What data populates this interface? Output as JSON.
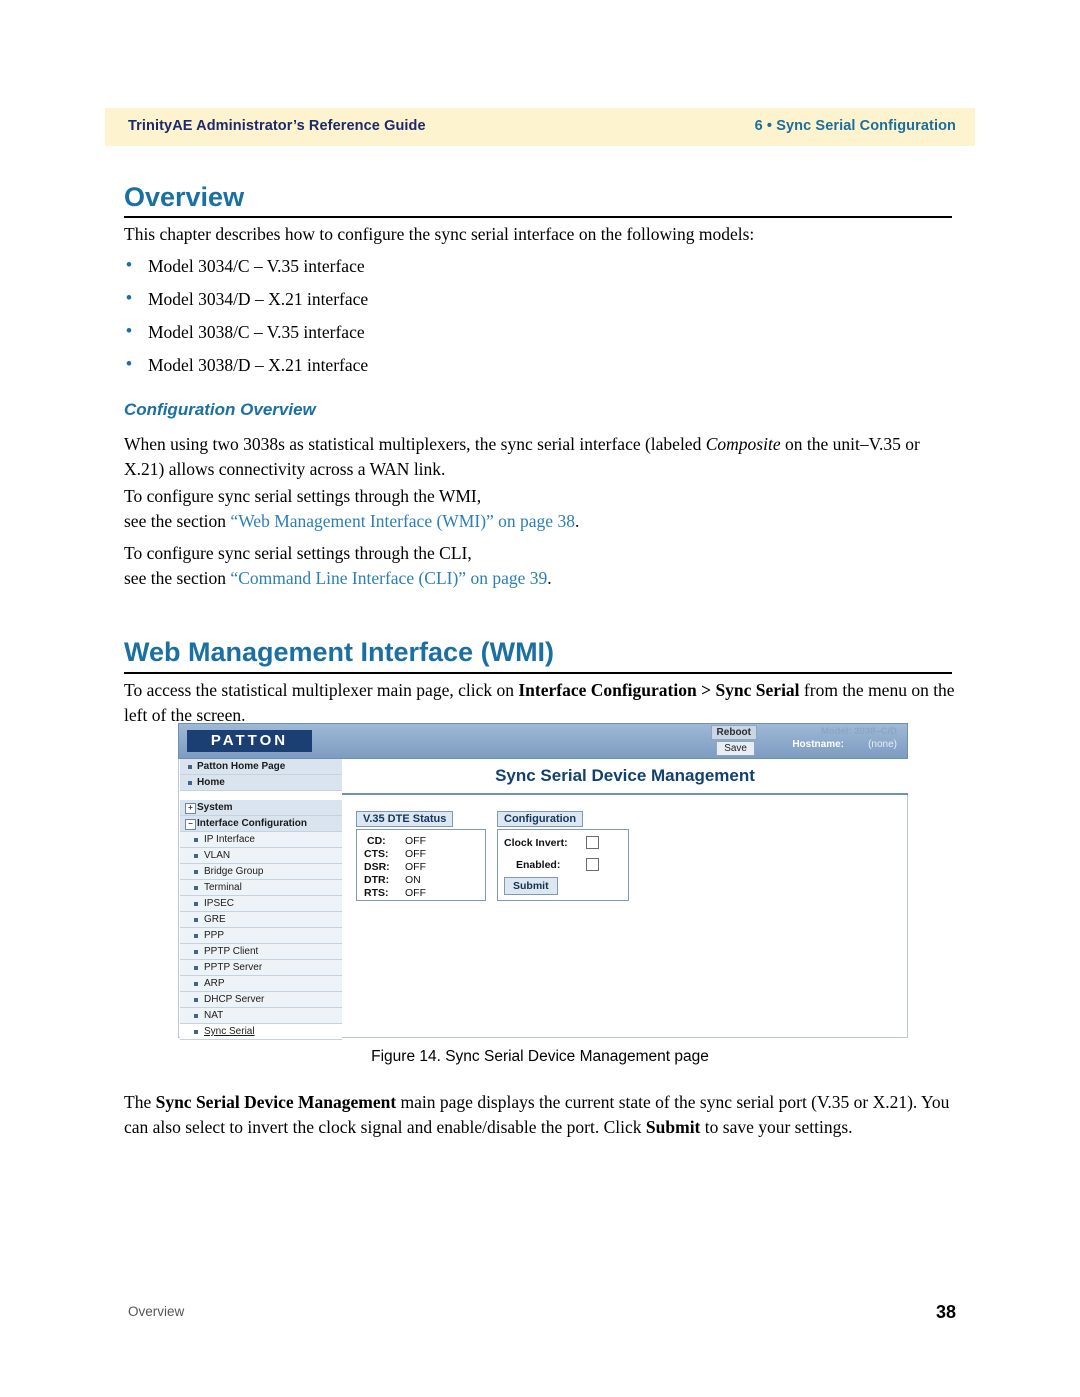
{
  "header": {
    "left": "TrinityAE Administrator’s Reference Guide",
    "right": "6 • Sync Serial Configuration"
  },
  "overview": {
    "heading": "Overview",
    "intro": "This chapter describes how to configure the sync serial interface on the following models:",
    "models": [
      "Model 3034/C – V.35 interface",
      "Model 3034/D – X.21 interface",
      "Model 3038/C – V.35 interface",
      "Model 3038/D – X.21 interface"
    ],
    "config_heading": "Configuration Overview",
    "para1_a": "When using two 3038s as statistical multiplexers, the sync serial interface (labeled ",
    "para1_italic": "Composite",
    "para1_b": " on the unit–V.35 or X.21) allows connectivity across a WAN link.",
    "para2": "To configure sync serial settings through the WMI,",
    "para3_a": "see the section ",
    "para3_link": "“Web Management Interface (WMI)” on page 38",
    "para3_b": ".",
    "para4": "To configure sync serial settings through the CLI,",
    "para5_a": "see the section ",
    "para5_link": "“Command Line Interface (CLI)” on page 39",
    "para5_b": "."
  },
  "wmi_section": {
    "heading": "Web Management Interface (WMI)",
    "para_a": "To access the statistical multiplexer main page, click on ",
    "para_bold": "Interface Configuration > Sync Serial",
    "para_b": " from the menu on the left of the screen.",
    "figure_caption": "Figure 14. Sync Serial Device Management page",
    "closing_a": "The ",
    "closing_bold1": "Sync Serial Device Management",
    "closing_b": " main page displays the current state of the sync serial port (V.35 or X.21). You can also select to invert the clock signal and enable/disable the port. Click ",
    "closing_bold2": "Submit",
    "closing_c": " to save your settings."
  },
  "screenshot": {
    "logo": "PATTON",
    "reboot_button": "Reboot",
    "save_button": "Save",
    "model_label": "Model: 3038–C/D",
    "hostname_label": "Hostname:",
    "hostname_value": "(none)",
    "page_title": "Sync Serial Device Management",
    "menu": [
      {
        "label": "Patton Home Page",
        "type": "head"
      },
      {
        "label": "Home",
        "type": "head"
      },
      {
        "label": "System",
        "type": "plus",
        "glyph": "+"
      },
      {
        "label": "Interface Configuration",
        "type": "plus",
        "glyph": "−"
      },
      {
        "label": "IP Interface",
        "type": "item"
      },
      {
        "label": "VLAN",
        "type": "item"
      },
      {
        "label": "Bridge Group",
        "type": "item"
      },
      {
        "label": "Terminal",
        "type": "item"
      },
      {
        "label": "IPSEC",
        "type": "item"
      },
      {
        "label": "GRE",
        "type": "item"
      },
      {
        "label": "PPP",
        "type": "item"
      },
      {
        "label": "PPTP Client",
        "type": "item"
      },
      {
        "label": "PPTP Server",
        "type": "item"
      },
      {
        "label": "ARP",
        "type": "item"
      },
      {
        "label": "DHCP Server",
        "type": "item"
      },
      {
        "label": "NAT",
        "type": "item"
      },
      {
        "label": "Sync Serial",
        "type": "selected"
      }
    ],
    "status_panel": {
      "tab": "V.35 DTE Status",
      "rows": [
        {
          "name": "CD:",
          "value": "OFF"
        },
        {
          "name": "CTS:",
          "value": "OFF"
        },
        {
          "name": "DSR:",
          "value": "OFF"
        },
        {
          "name": "DTR:",
          "value": "ON"
        },
        {
          "name": "RTS:",
          "value": "OFF"
        }
      ]
    },
    "config_panel": {
      "tab": "Configuration",
      "clock_invert_label": "Clock Invert:",
      "enabled_label": "Enabled:",
      "submit_label": "Submit"
    }
  },
  "footer": {
    "left": "Overview",
    "page": "38"
  }
}
